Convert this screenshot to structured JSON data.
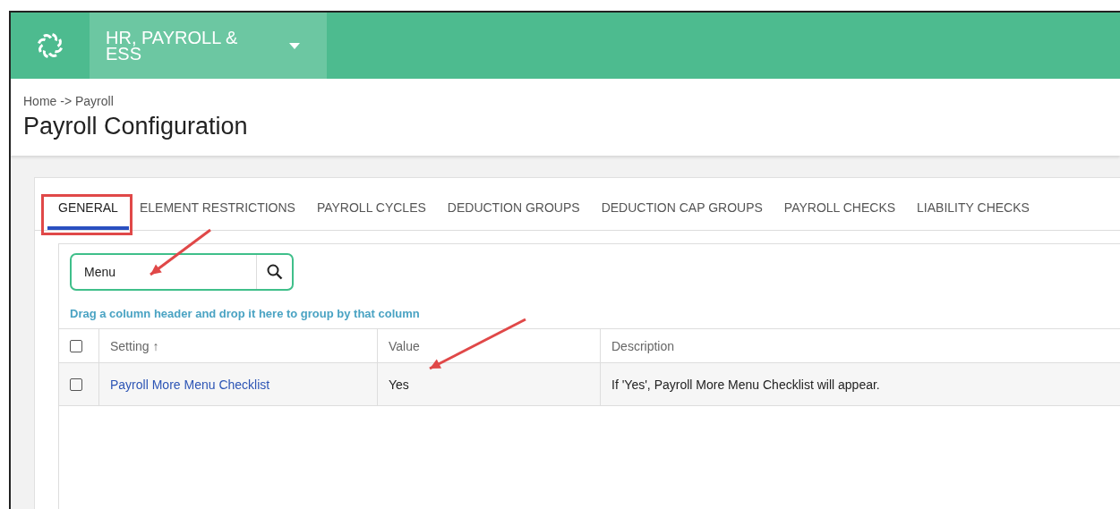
{
  "header": {
    "product": "HR, PAYROLL & ESS"
  },
  "breadcrumb": "Home -> Payroll",
  "page_title": "Payroll Configuration",
  "tabs": [
    {
      "label": "GENERAL",
      "selected": true
    },
    {
      "label": "ELEMENT RESTRICTIONS",
      "selected": false
    },
    {
      "label": "PAYROLL CYCLES",
      "selected": false
    },
    {
      "label": "DEDUCTION GROUPS",
      "selected": false
    },
    {
      "label": "DEDUCTION CAP GROUPS",
      "selected": false
    },
    {
      "label": "PAYROLL CHECKS",
      "selected": false
    },
    {
      "label": "LIABILITY CHECKS",
      "selected": false
    }
  ],
  "search": {
    "value": "Menu"
  },
  "group_hint": "Drag a column header and drop it here to group by that column",
  "table": {
    "select_all_checked": false,
    "columns": [
      {
        "label": "Setting",
        "sort": "↑"
      },
      {
        "label": "Value"
      },
      {
        "label": "Description"
      }
    ],
    "rows": [
      {
        "checked": false,
        "setting": "Payroll More Menu Checklist",
        "value": "Yes",
        "description": "If 'Yes', Payroll More Menu Checklist will appear."
      }
    ]
  }
}
